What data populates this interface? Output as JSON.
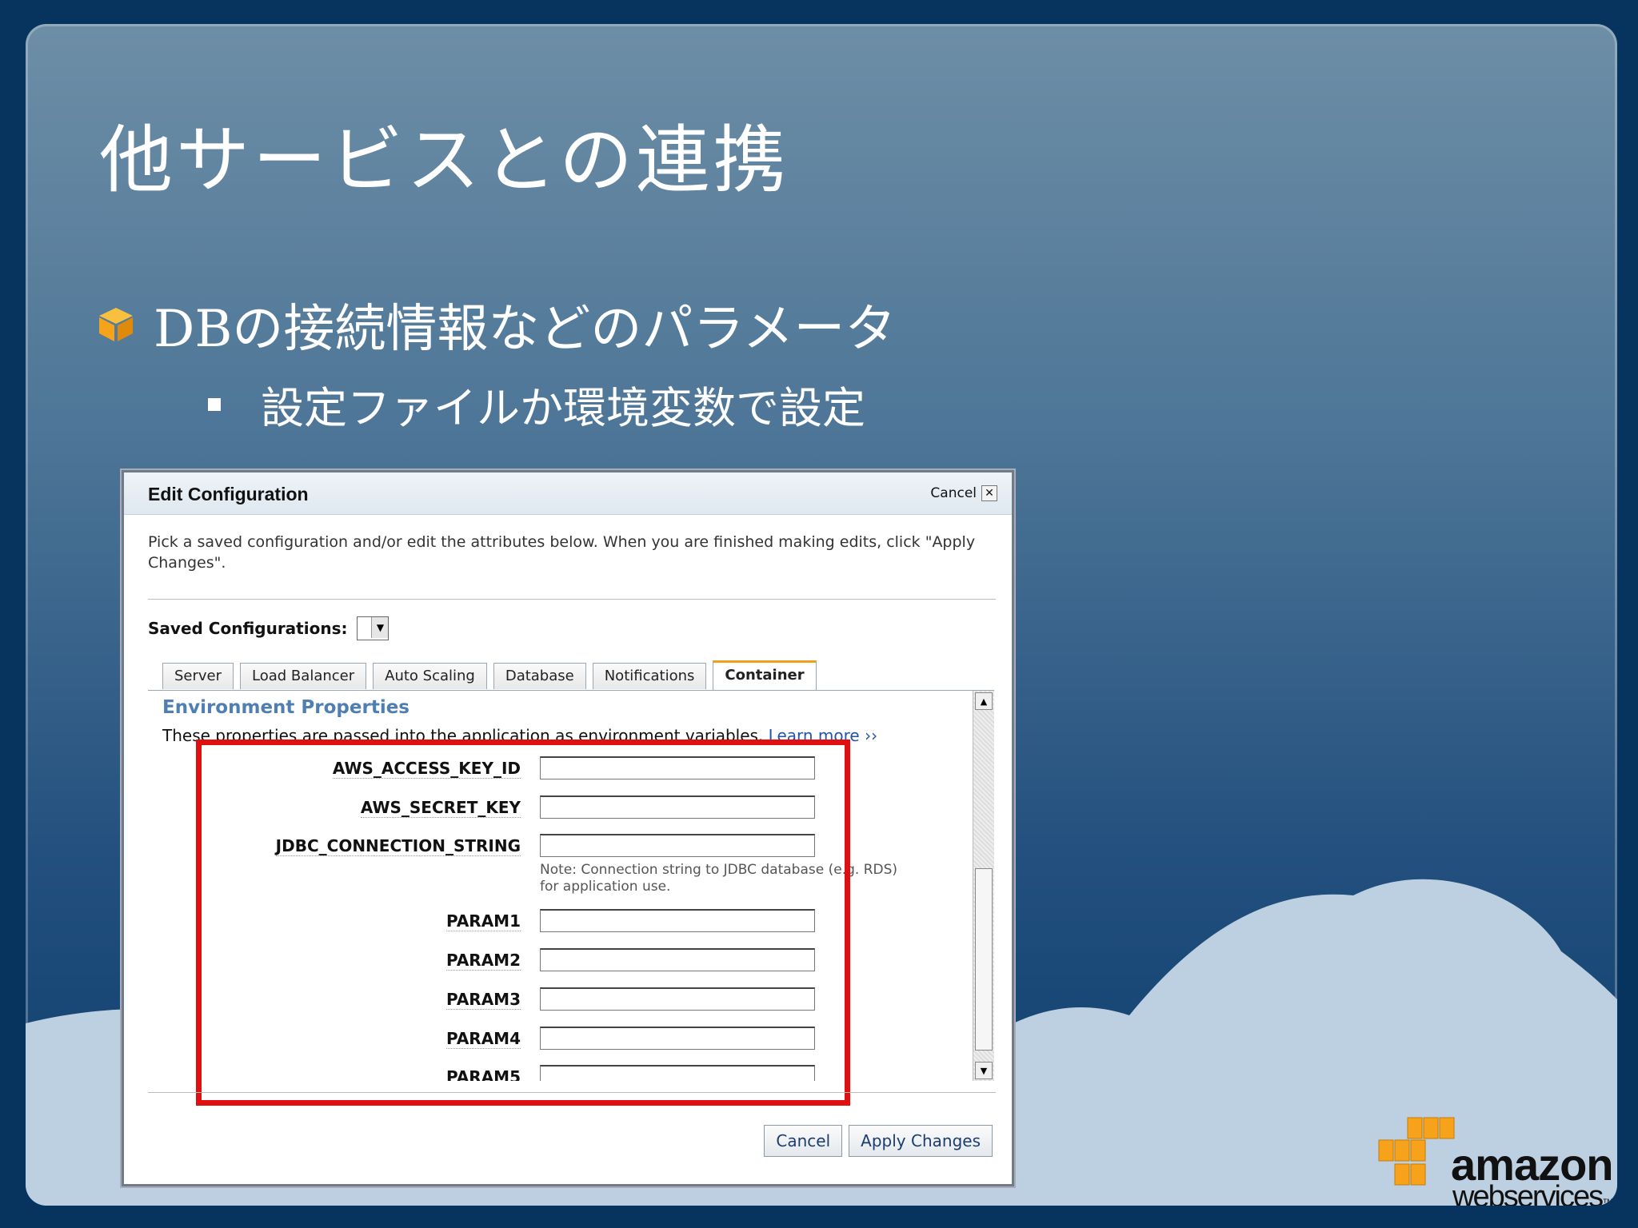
{
  "slide": {
    "title": "他サービスとの連携",
    "bullet1": "DBの接続情報などのパラメータ",
    "bullet2": "設定ファイルか環境変数で設定"
  },
  "dialog": {
    "title": "Edit Configuration",
    "cancel_link": "Cancel",
    "close_glyph": "✕",
    "intro": "Pick a saved configuration and/or edit the attributes below. When you are finished making edits, click \"Apply Changes\".",
    "saved_label": "Saved Configurations:",
    "tabs": [
      "Server",
      "Load Balancer",
      "Auto Scaling",
      "Database",
      "Notifications",
      "Container"
    ],
    "active_tab": "Container",
    "section_title": "Environment Properties",
    "section_desc": "These properties are passed into the application as environment variables.",
    "learn_more": "Learn more ››",
    "fields": [
      {
        "label": "AWS_ACCESS_KEY_ID",
        "value": ""
      },
      {
        "label": "AWS_SECRET_KEY",
        "value": ""
      },
      {
        "label": "JDBC_CONNECTION_STRING",
        "value": ""
      },
      {
        "label": "PARAM1",
        "value": ""
      },
      {
        "label": "PARAM2",
        "value": ""
      },
      {
        "label": "PARAM3",
        "value": ""
      },
      {
        "label": "PARAM4",
        "value": ""
      },
      {
        "label": "PARAM5",
        "value": ""
      }
    ],
    "jdbc_note": "Note: Connection string to JDBC database (e.g. RDS) for application use.",
    "cancel_button": "Cancel",
    "apply_button": "Apply Changes"
  },
  "logo": {
    "line1": "amazon",
    "line2": "webservices",
    "tm": "™"
  },
  "colors": {
    "highlight": "#e01010",
    "tab_accent": "#f0a020",
    "section_title": "#4f7fb2",
    "aws_orange": "#f7a21b"
  }
}
